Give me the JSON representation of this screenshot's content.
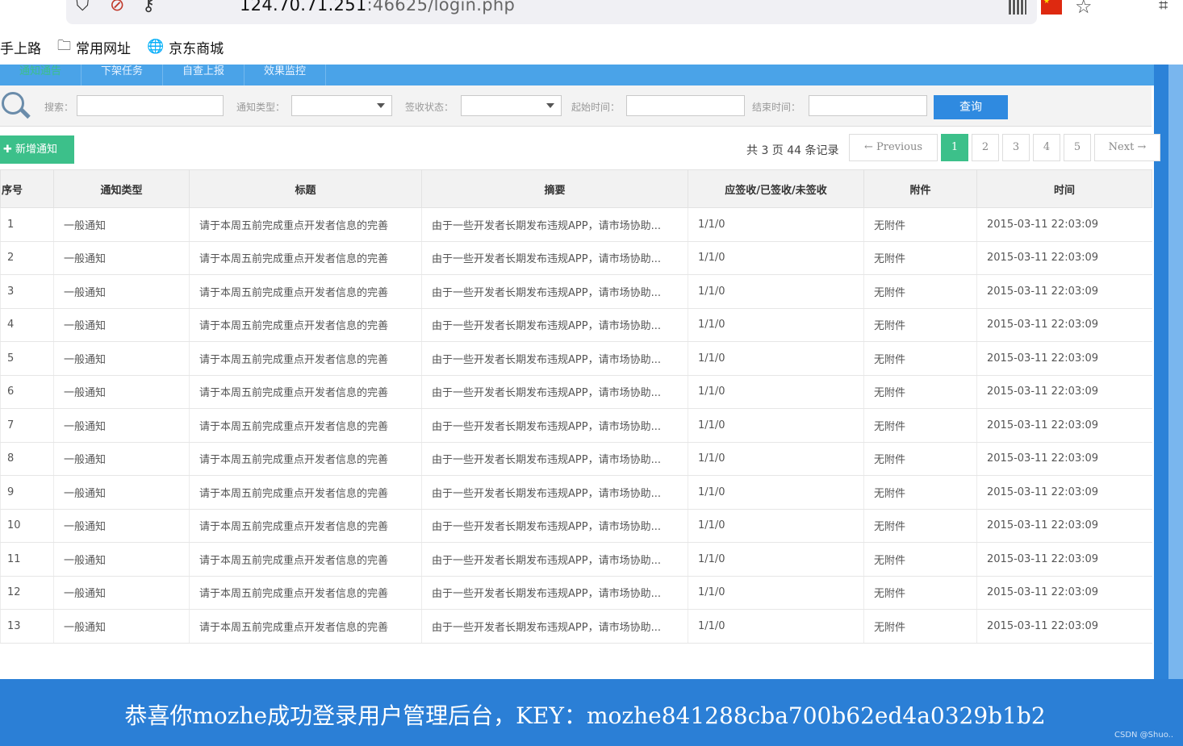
{
  "browser": {
    "url_host": "124.70.71.251",
    "url_rest": ":46625/login.php",
    "bookmarks": [
      {
        "label": "手上路",
        "icon": ""
      },
      {
        "label": "常用网址",
        "icon": "folder-icon"
      },
      {
        "label": "京东商城",
        "icon": "globe-icon"
      }
    ]
  },
  "nav": {
    "items": [
      "通知通告",
      "下架任务",
      "自查上报",
      "效果监控"
    ],
    "active_index": 0
  },
  "search": {
    "keyword_label": "搜索：",
    "type_label": "通知类型：",
    "status_label": "签收状态：",
    "start_label": "起始时间：",
    "end_label": "结束时间：",
    "query_button": "查询"
  },
  "toolbar": {
    "add_button": "✚ 新增通知",
    "records_text": "共 3 页 44 条记录"
  },
  "pagination": {
    "previous": "← Previous",
    "pages": [
      "1",
      "2",
      "3",
      "4",
      "5"
    ],
    "current": "1",
    "next": "Next →"
  },
  "table": {
    "columns": [
      "序号",
      "通知类型",
      "标题",
      "摘要",
      "应签收/已签收/未签收",
      "附件",
      "时间"
    ],
    "rows": [
      [
        "1",
        "一般通知",
        "请于本周五前完成重点开发者信息的完善",
        "由于一些开发者长期发布违规APP，请市场协助...",
        "1/1/0",
        "无附件",
        "2015-03-11 22:03:09"
      ],
      [
        "2",
        "一般通知",
        "请于本周五前完成重点开发者信息的完善",
        "由于一些开发者长期发布违规APP，请市场协助...",
        "1/1/0",
        "无附件",
        "2015-03-11 22:03:09"
      ],
      [
        "3",
        "一般通知",
        "请于本周五前完成重点开发者信息的完善",
        "由于一些开发者长期发布违规APP，请市场协助...",
        "1/1/0",
        "无附件",
        "2015-03-11 22:03:09"
      ],
      [
        "4",
        "一般通知",
        "请于本周五前完成重点开发者信息的完善",
        "由于一些开发者长期发布违规APP，请市场协助...",
        "1/1/0",
        "无附件",
        "2015-03-11 22:03:09"
      ],
      [
        "5",
        "一般通知",
        "请于本周五前完成重点开发者信息的完善",
        "由于一些开发者长期发布违规APP，请市场协助...",
        "1/1/0",
        "无附件",
        "2015-03-11 22:03:09"
      ],
      [
        "6",
        "一般通知",
        "请于本周五前完成重点开发者信息的完善",
        "由于一些开发者长期发布违规APP，请市场协助...",
        "1/1/0",
        "无附件",
        "2015-03-11 22:03:09"
      ],
      [
        "7",
        "一般通知",
        "请于本周五前完成重点开发者信息的完善",
        "由于一些开发者长期发布违规APP，请市场协助...",
        "1/1/0",
        "无附件",
        "2015-03-11 22:03:09"
      ],
      [
        "8",
        "一般通知",
        "请于本周五前完成重点开发者信息的完善",
        "由于一些开发者长期发布违规APP，请市场协助...",
        "1/1/0",
        "无附件",
        "2015-03-11 22:03:09"
      ],
      [
        "9",
        "一般通知",
        "请于本周五前完成重点开发者信息的完善",
        "由于一些开发者长期发布违规APP，请市场协助...",
        "1/1/0",
        "无附件",
        "2015-03-11 22:03:09"
      ],
      [
        "10",
        "一般通知",
        "请于本周五前完成重点开发者信息的完善",
        "由于一些开发者长期发布违规APP，请市场协助...",
        "1/1/0",
        "无附件",
        "2015-03-11 22:03:09"
      ],
      [
        "11",
        "一般通知",
        "请于本周五前完成重点开发者信息的完善",
        "由于一些开发者长期发布违规APP，请市场协助...",
        "1/1/0",
        "无附件",
        "2015-03-11 22:03:09"
      ],
      [
        "12",
        "一般通知",
        "请于本周五前完成重点开发者信息的完善",
        "由于一些开发者长期发布违规APP，请市场协助...",
        "1/1/0",
        "无附件",
        "2015-03-11 22:03:09"
      ],
      [
        "13",
        "一般通知",
        "请于本周五前完成重点开发者信息的完善",
        "由于一些开发者长期发布违规APP，请市场协助...",
        "1/1/0",
        "无附件",
        "2015-03-11 22:03:09"
      ]
    ]
  },
  "banner": {
    "text": "恭喜你mozhe成功登录用户管理后台，KEY：mozhe841288cba700b62ed4a0329b1b2",
    "watermark": "CSDN @Shuo.."
  },
  "colors": {
    "nav_bg": "#4aa3e8",
    "accent_green": "#3cc08a",
    "query_blue": "#2f8ae0",
    "banner_blue": "#2b7fd6"
  }
}
